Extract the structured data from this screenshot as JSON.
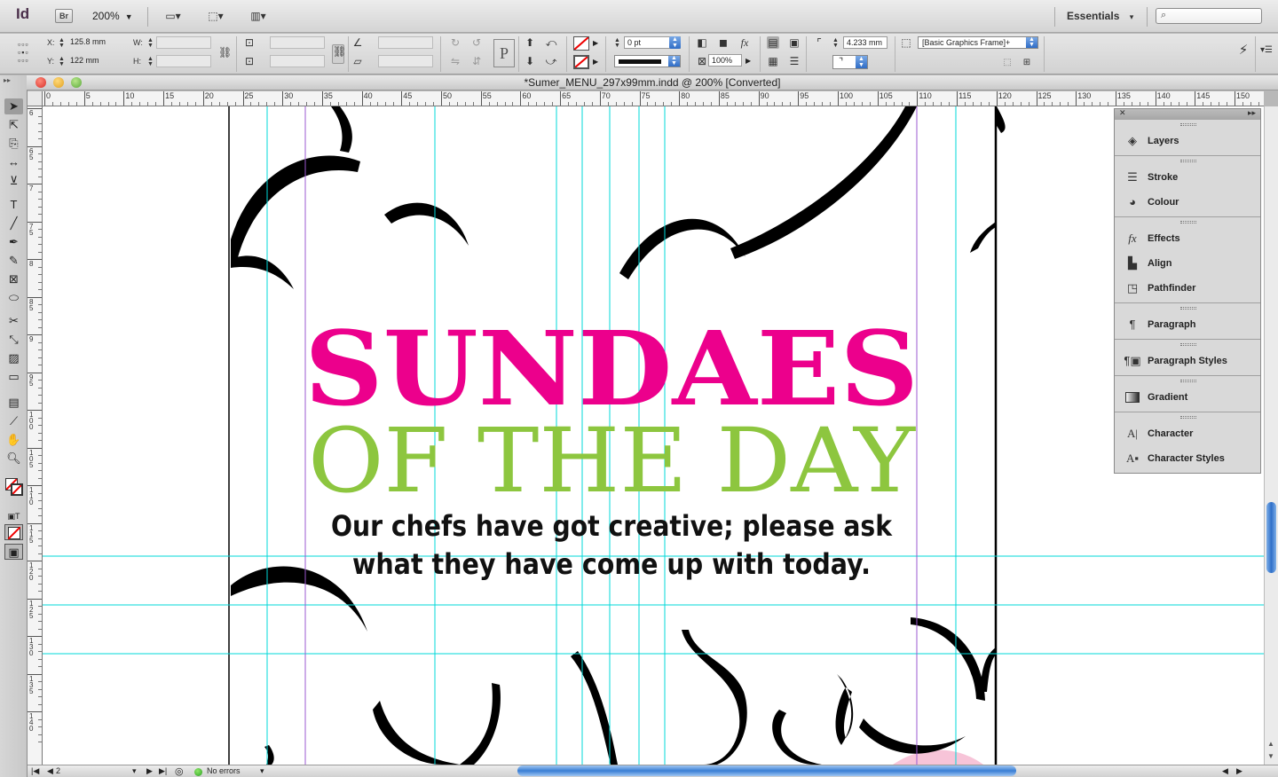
{
  "app": {
    "logo": "Id",
    "bridge": "Br",
    "zoom": "200%",
    "workspace": "Essentials",
    "search_icon": "⌕"
  },
  "control": {
    "x_label": "X:",
    "x_value": "125.8 mm",
    "y_label": "Y:",
    "y_value": "122 mm",
    "w_label": "W:",
    "h_label": "H:",
    "stroke_weight": "0 pt",
    "opacity": "100%",
    "corner_size": "4.233 mm",
    "object_style": "[Basic Graphics Frame]+",
    "text_icon": "P"
  },
  "document": {
    "title": "*Sumer_MENU_297x99mm.indd @ 200% [Converted]"
  },
  "rulers": {
    "top_ticks": [
      "0",
      "5",
      "10",
      "15",
      "20",
      "25",
      "30",
      "35",
      "40",
      "45",
      "50",
      "55",
      "60",
      "65",
      "70",
      "75",
      "80",
      "85",
      "90",
      "95",
      "100",
      "105",
      "110",
      "115",
      "120",
      "125",
      "130",
      "135",
      "140",
      "145",
      "150"
    ],
    "left_ticks": [
      "6",
      "6 5",
      "7",
      "7 5",
      "8",
      "8 5",
      "9",
      "9 5",
      "1 0 0",
      "1 0 5",
      "1 1 0",
      "1 1 5",
      "1 2 0",
      "1 2 5",
      "1 3 0",
      "1 3 5",
      "1 4 0"
    ]
  },
  "page": {
    "headline": "SUNDAES",
    "subhead": "OF THE DAY",
    "body_line1": "Our chefs have got creative; please ask",
    "body_line2": "what they have come up with today.",
    "colors": {
      "headline": "#ec008c",
      "subhead": "#8dc63f",
      "body": "#111111",
      "guide": "#00d8d8",
      "margin_guide": "#9b59d0",
      "pink_fill": "#f7c4d8"
    }
  },
  "panels": {
    "items": [
      "Layers",
      "Stroke",
      "Colour",
      "Effects",
      "Align",
      "Pathfinder",
      "Paragraph",
      "Paragraph Styles",
      "Gradient",
      "Character",
      "Character Styles"
    ]
  },
  "status": {
    "page_number": "2",
    "preflight": "No errors"
  }
}
